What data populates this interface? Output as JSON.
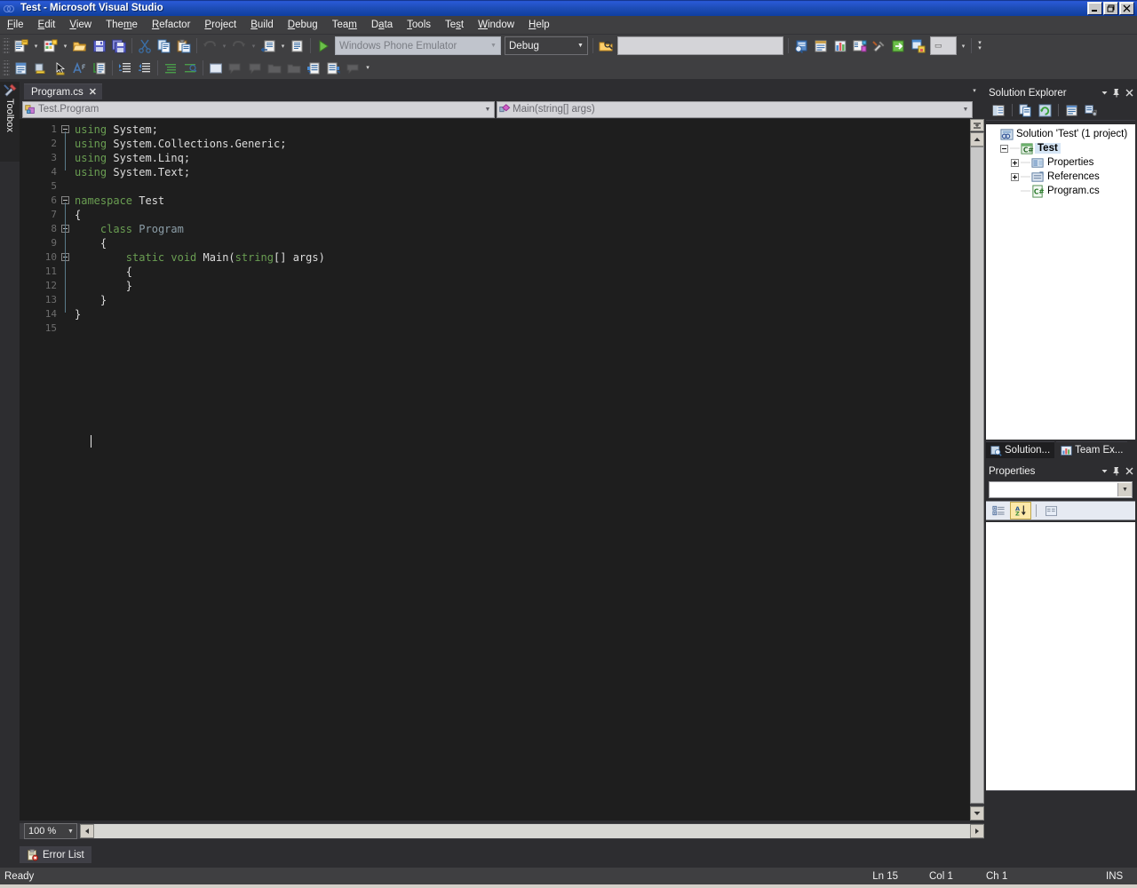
{
  "window": {
    "title": "Test - Microsoft Visual Studio",
    "icon": "visual-studio-icon",
    "controls": {
      "minimize": "minimize-icon",
      "restore": "restore-icon",
      "close": "close-icon"
    }
  },
  "menubar": {
    "items": [
      {
        "label": "File",
        "accel": "F"
      },
      {
        "label": "Edit",
        "accel": "E"
      },
      {
        "label": "View",
        "accel": "V"
      },
      {
        "label": "Theme",
        "accel": "m"
      },
      {
        "label": "Refactor",
        "accel": "R"
      },
      {
        "label": "Project",
        "accel": "P"
      },
      {
        "label": "Build",
        "accel": "B"
      },
      {
        "label": "Debug",
        "accel": "D"
      },
      {
        "label": "Team",
        "accel": "m"
      },
      {
        "label": "Data",
        "accel": "a"
      },
      {
        "label": "Tools",
        "accel": "T"
      },
      {
        "label": "Test",
        "accel": "s"
      },
      {
        "label": "Window",
        "accel": "W"
      },
      {
        "label": "Help",
        "accel": "H"
      }
    ]
  },
  "toolbar": {
    "target_platform": {
      "value": "Windows Phone Emulator",
      "enabled": false
    },
    "configuration": {
      "value": "Debug",
      "enabled": true
    },
    "find_box": {
      "value": "",
      "placeholder": ""
    },
    "row1_buttons": [
      "new-project-icon",
      "add-new-item-icon",
      "open-file-icon",
      "save-icon",
      "save-all-icon",
      "cut-icon",
      "copy-icon",
      "paste-icon",
      "undo-icon",
      "redo-icon",
      "navigate-backward-icon",
      "navigate-forward-icon",
      "start-debugging-icon"
    ],
    "row2_buttons": [
      "window-icon",
      "new-list-item-icon",
      "pointer-icon",
      "font-icon",
      "properties-window-icon",
      "indent-left-icon",
      "indent-right-icon",
      "align-icon",
      "find-symbol-icon",
      "blank-panel-icon",
      "comment-icon",
      "uncomment-icon",
      "collapse-icon",
      "expand-icon",
      "bookmark-next-icon",
      "bookmark-prev-icon",
      "clear-bookmarks-icon"
    ]
  },
  "toolbox": {
    "label": "Toolbox",
    "icon": "toolbox-icon"
  },
  "editor": {
    "tab": {
      "label": "Program.cs",
      "close": "✕"
    },
    "nav_left": {
      "value": "Test.Program",
      "icon": "class-icon"
    },
    "nav_right": {
      "value": "Main(string[] args)",
      "icon": "method-icon"
    },
    "zoom": {
      "value": "100 %"
    },
    "lines": [
      {
        "n": "1",
        "fold": "minus",
        "tokens": [
          {
            "t": "using",
            "c": "kw"
          },
          {
            "t": " System;",
            "c": "id"
          }
        ]
      },
      {
        "n": "2",
        "fold": "",
        "tokens": [
          {
            "t": "using",
            "c": "kw"
          },
          {
            "t": " System.Collections.Generic;",
            "c": "id"
          }
        ]
      },
      {
        "n": "3",
        "fold": "",
        "tokens": [
          {
            "t": "using",
            "c": "kw"
          },
          {
            "t": " System.Linq;",
            "c": "id"
          }
        ]
      },
      {
        "n": "4",
        "fold": "",
        "tokens": [
          {
            "t": "using",
            "c": "kw"
          },
          {
            "t": " System.Text;",
            "c": "id"
          }
        ]
      },
      {
        "n": "5",
        "fold": "",
        "tokens": []
      },
      {
        "n": "6",
        "fold": "minus",
        "tokens": [
          {
            "t": "namespace",
            "c": "kw"
          },
          {
            "t": " Test",
            "c": "id"
          }
        ]
      },
      {
        "n": "7",
        "fold": "",
        "tokens": [
          {
            "t": "{",
            "c": "pl"
          }
        ]
      },
      {
        "n": "8",
        "fold": "minus",
        "tokens": [
          {
            "t": "    class",
            "c": "kw"
          },
          {
            "t": " ",
            "c": "pl"
          },
          {
            "t": "Program",
            "c": "ty"
          }
        ]
      },
      {
        "n": "9",
        "fold": "",
        "tokens": [
          {
            "t": "    {",
            "c": "pl"
          }
        ]
      },
      {
        "n": "10",
        "fold": "minus",
        "tokens": [
          {
            "t": "        static void",
            "c": "kw"
          },
          {
            "t": " ",
            "c": "pl"
          },
          {
            "t": "Main",
            "c": "id"
          },
          {
            "t": "(",
            "c": "pl"
          },
          {
            "t": "string",
            "c": "kw"
          },
          {
            "t": "[] args)",
            "c": "id"
          }
        ]
      },
      {
        "n": "11",
        "fold": "",
        "tokens": [
          {
            "t": "        {",
            "c": "pl"
          }
        ]
      },
      {
        "n": "12",
        "fold": "",
        "tokens": [
          {
            "t": "        }",
            "c": "pl"
          }
        ]
      },
      {
        "n": "13",
        "fold": "",
        "tokens": [
          {
            "t": "    }",
            "c": "pl"
          }
        ]
      },
      {
        "n": "14",
        "fold": "",
        "tokens": [
          {
            "t": "}",
            "c": "pl"
          }
        ]
      },
      {
        "n": "15",
        "fold": "",
        "tokens": []
      }
    ]
  },
  "solution_explorer": {
    "title": "Solution Explorer",
    "toolbar": [
      "properties-icon",
      "show-all-files-icon",
      "refresh-icon",
      "view-code-icon",
      "view-designer-icon"
    ],
    "tree": [
      {
        "label": "Solution 'Test' (1 project)",
        "indent": 0,
        "expander": "none",
        "icon": "solution-icon",
        "selected": false,
        "bold": false
      },
      {
        "label": "Test",
        "indent": 1,
        "expander": "minus",
        "icon": "csharp-project-icon",
        "selected": true,
        "bold": true
      },
      {
        "label": "Properties",
        "indent": 2,
        "expander": "plus",
        "icon": "properties-folder-icon",
        "selected": false,
        "bold": false
      },
      {
        "label": "References",
        "indent": 2,
        "expander": "plus",
        "icon": "references-folder-icon",
        "selected": false,
        "bold": false
      },
      {
        "label": "Program.cs",
        "indent": 2,
        "expander": "none",
        "icon": "csharp-file-icon",
        "selected": false,
        "bold": false
      }
    ],
    "tabs": [
      {
        "label": "Solution...",
        "icon": "solution-explorer-icon",
        "active": true
      },
      {
        "label": "Team Ex...",
        "icon": "team-explorer-icon",
        "active": false
      }
    ]
  },
  "properties_panel": {
    "title": "Properties",
    "object_selector": {
      "value": ""
    },
    "toolbar": [
      "categorized-icon",
      "alphabetical-icon",
      "property-pages-icon"
    ]
  },
  "bottom": {
    "error_list_tab": {
      "label": "Error List",
      "icon": "error-list-icon"
    }
  },
  "statusbar": {
    "status": "Ready",
    "line": "Ln 15",
    "column": "Col 1",
    "character": "Ch 1",
    "insert_mode": "INS"
  },
  "colors": {
    "title_bar": "#1e4db7",
    "chrome": "#3f3f41",
    "editor_bg": "#1e1e1e",
    "keyword_green": "#6a9e52",
    "identifier": "#dcdcdc",
    "type_gray": "#8c9ea8",
    "selection_blue": "#d5e5f5"
  }
}
